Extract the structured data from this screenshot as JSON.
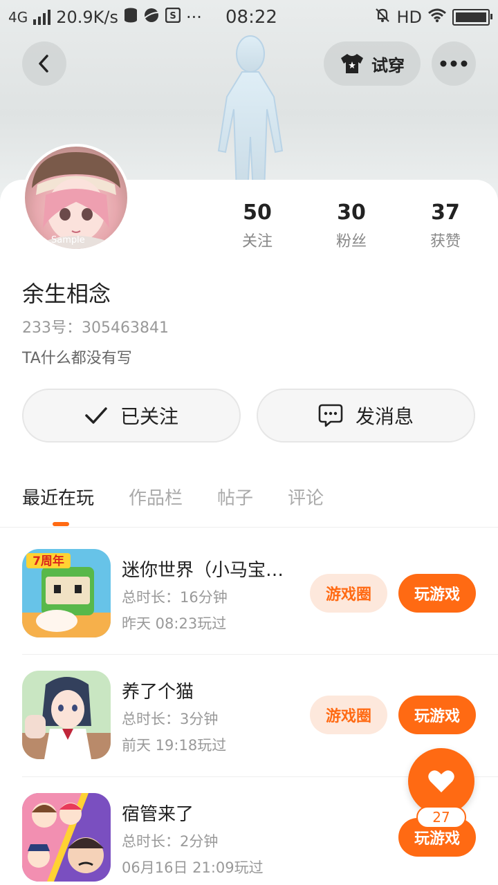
{
  "status_bar": {
    "network": "4G",
    "speed": "20.9K/s",
    "dots": "···",
    "time": "08:22",
    "hd": "HD"
  },
  "header": {
    "tryon_label": "试穿"
  },
  "profile": {
    "avatar_watermark": "Sample",
    "username": "余生相念",
    "uid": "233号：305463841",
    "bio": "TA什么都没有写",
    "stats": [
      {
        "value": "50",
        "label": "关注"
      },
      {
        "value": "30",
        "label": "粉丝"
      },
      {
        "value": "37",
        "label": "获赞"
      }
    ],
    "follow_label": "已关注",
    "message_label": "发消息"
  },
  "tabs": [
    "最近在玩",
    "作品栏",
    "帖子",
    "评论"
  ],
  "games": [
    {
      "title": "迷你世界（小马宝…",
      "duration": "总时长：16分钟",
      "last_played": "昨天 08:23玩过",
      "circle_label": "游戏圈",
      "play_label": "玩游戏",
      "icon_badge": "7周年"
    },
    {
      "title": "养了个猫",
      "duration": "总时长：3分钟",
      "last_played": "前天 19:18玩过",
      "circle_label": "游戏圈",
      "play_label": "玩游戏"
    },
    {
      "title": "宿管来了",
      "duration": "总时长：2分钟",
      "last_played": "06月16日 21:09玩过",
      "play_label": "玩游戏"
    }
  ],
  "fab": {
    "count": "27"
  },
  "colors": {
    "accent": "#ff6a13",
    "accent_light": "#fde8dc"
  }
}
